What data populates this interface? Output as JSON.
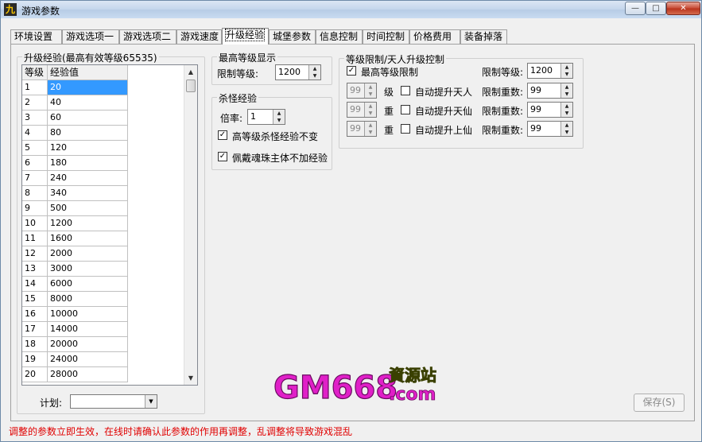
{
  "window": {
    "title": "游戏参数",
    "app_icon_glyph": "九",
    "controls": {
      "minimize": "—",
      "maximize": "□",
      "close": "✕"
    }
  },
  "tabs": [
    {
      "label": "环境设置",
      "active": false
    },
    {
      "label": "游戏选项一",
      "active": false
    },
    {
      "label": "游戏选项二",
      "active": false
    },
    {
      "label": "游戏速度",
      "active": false
    },
    {
      "label": "升级经验",
      "active": true
    },
    {
      "label": "城堡参数",
      "active": false
    },
    {
      "label": "信息控制",
      "active": false
    },
    {
      "label": "时间控制",
      "active": false
    },
    {
      "label": "价格费用",
      "active": false
    },
    {
      "label": "装备掉落",
      "active": false
    }
  ],
  "exp_group": {
    "title": "升级经验(最高有效等级65535)",
    "columns": [
      "等级",
      "经验值"
    ],
    "rows": [
      {
        "level": "1",
        "exp": "20"
      },
      {
        "level": "2",
        "exp": "40"
      },
      {
        "level": "3",
        "exp": "60"
      },
      {
        "level": "4",
        "exp": "80"
      },
      {
        "level": "5",
        "exp": "120"
      },
      {
        "level": "6",
        "exp": "180"
      },
      {
        "level": "7",
        "exp": "240"
      },
      {
        "level": "8",
        "exp": "340"
      },
      {
        "level": "9",
        "exp": "500"
      },
      {
        "level": "10",
        "exp": "1200"
      },
      {
        "level": "11",
        "exp": "1600"
      },
      {
        "level": "12",
        "exp": "2000"
      },
      {
        "level": "13",
        "exp": "3000"
      },
      {
        "level": "14",
        "exp": "6000"
      },
      {
        "level": "15",
        "exp": "8000"
      },
      {
        "level": "16",
        "exp": "10000"
      },
      {
        "level": "17",
        "exp": "14000"
      },
      {
        "level": "18",
        "exp": "20000"
      },
      {
        "level": "19",
        "exp": "24000"
      },
      {
        "level": "20",
        "exp": "28000"
      }
    ],
    "plan_label": "计划:",
    "plan_value": ""
  },
  "max_level_group": {
    "title": "最高等级显示",
    "limit_label": "限制等级:",
    "limit_value": "1200"
  },
  "kill_exp_group": {
    "title": "杀怪经验",
    "rate_label": "倍率:",
    "rate_value": "1",
    "opt1": {
      "label": "高等级杀怪经验不变",
      "checked": true
    },
    "opt2": {
      "label": "佩戴魂珠主体不加经验",
      "checked": true
    }
  },
  "level_limit_group": {
    "title": "等级限制/天人升级控制",
    "max_limit": {
      "label": "最高等级限制",
      "checked": true
    },
    "limit_level_label": "限制等级:",
    "limit_level_value": "1200",
    "rows": [
      {
        "value": "99",
        "unit": "级",
        "auto_label": "自动提升天人",
        "auto_checked": false,
        "limit_label": "限制重数:",
        "limit_value": "99"
      },
      {
        "value": "99",
        "unit": "重",
        "auto_label": "自动提升天仙",
        "auto_checked": false,
        "limit_label": "限制重数:",
        "limit_value": "99"
      },
      {
        "value": "99",
        "unit": "重",
        "auto_label": "自动提升上仙",
        "auto_checked": false,
        "limit_label": "限制重数:",
        "limit_value": "99"
      }
    ]
  },
  "save_button": "保存(S)",
  "watermark": {
    "main": "GM668",
    "cn": "資源站",
    "sub": ".com"
  },
  "status_text": "调整的参数立即生效，在线时请确认此参数的作用再调整，乱调整将导致游戏混乱",
  "colors": {
    "status_red": "#e00000",
    "selection_blue": "#3399ff",
    "watermark_magenta": "#e020c8"
  }
}
